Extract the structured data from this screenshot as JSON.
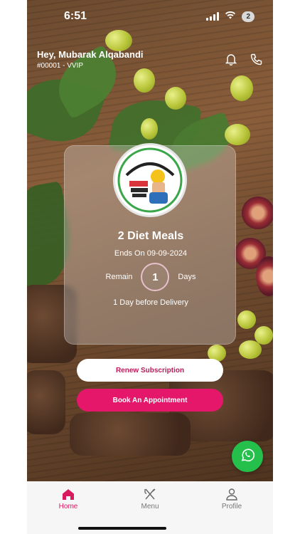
{
  "status_bar": {
    "time": "6:51",
    "battery_badge": "2"
  },
  "header": {
    "greeting": "Hey, Mubarak Alqabandi",
    "member_code": "#00001 - VVIP",
    "icons": [
      "bell-icon",
      "phone-icon"
    ]
  },
  "subscription": {
    "plan_name": "2 Diet Meals",
    "ends_on": "Ends On 09-09-2024",
    "remain_label": "Remain",
    "days_remaining": "1",
    "days_label": "Days",
    "delivery_note": "1 Day before Delivery"
  },
  "actions": {
    "renew_label": "Renew Subscription",
    "book_label": "Book An Appointment"
  },
  "tabs": [
    {
      "label": "Home",
      "icon": "home-icon",
      "active": true
    },
    {
      "label": "Menu",
      "icon": "fork-knife-icon",
      "active": false
    },
    {
      "label": "Profile",
      "icon": "user-icon",
      "active": false
    }
  ],
  "colors": {
    "accent": "#e5176b",
    "whatsapp": "#25c04c"
  }
}
